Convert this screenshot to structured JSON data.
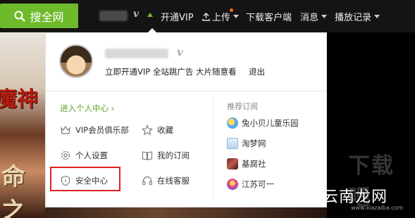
{
  "topbar": {
    "search_label": "搜全网",
    "vip_mark": "v",
    "nav": [
      "开通VIP",
      "上传",
      "下载客户端",
      "消息",
      "播放记录"
    ]
  },
  "background": {
    "left_text_top": "魔神",
    "left_text_bottom": "命之"
  },
  "dropdown": {
    "vip_mark": "v",
    "promo": "立即开通VIP 全站跳广告 大片随意看",
    "logout": "退出",
    "center_link": "进入个人中心 ›",
    "menu": {
      "vip_club": "VIP会员俱乐部",
      "favorites": "收藏",
      "settings": "个人设置",
      "my_subscriptions": "我的订阅",
      "security": "安全中心",
      "support": "在线客服"
    },
    "recommend_title": "推荐订阅",
    "recommend": [
      "兔小贝儿童乐园",
      "淘梦网",
      "基腐社",
      "江苏可一"
    ]
  },
  "watermark": {
    "top": "下载吧",
    "brand": "云南龙网",
    "url": "www.xiazaiba.com"
  },
  "colors": {
    "accent": "#6fba2c",
    "highlight_border": "#e02020",
    "link": "#5fa226"
  }
}
